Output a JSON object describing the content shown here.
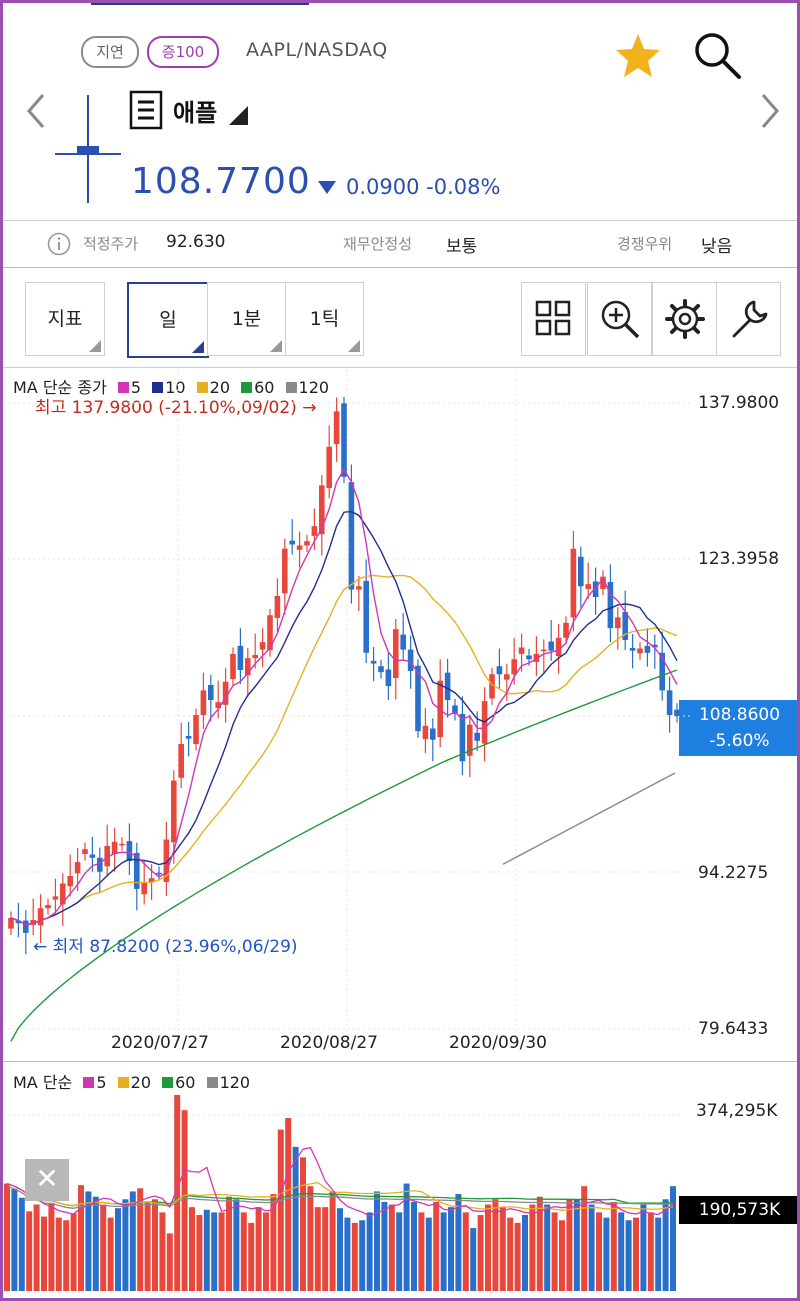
{
  "header": {
    "delay_label": "지연",
    "margin_label": "증100",
    "ticker": "AAPL/NASDAQ",
    "stock_name": "애플",
    "price": "108.7700",
    "change": "0.0900 -0.08%",
    "favorite_icon": "star-icon",
    "search_icon": "search-icon"
  },
  "info": {
    "fair_price_label": "적정주가",
    "fair_price_value": "92.630",
    "stability_label": "재무안정성",
    "stability_value": "보통",
    "competitive_label": "경쟁우위",
    "competitive_value": "낮음"
  },
  "toolbar": {
    "indicator": "지표",
    "period_day": "일",
    "period_min": "1분",
    "period_tick": "1틱",
    "icons": [
      "grid-icon",
      "zoom-in-icon",
      "gear-icon",
      "wrench-icon"
    ]
  },
  "colors": {
    "up": "#e8473c",
    "down": "#2a6fc9",
    "ma5": "#d236b5",
    "ma10": "#1f2f8f",
    "ma20": "#e6b020",
    "ma60": "#1f9a3a",
    "ma120": "#8a8a8a",
    "accent": "#1e7fe0",
    "frame": "#9b4fb0"
  },
  "chart_data": [
    {
      "type": "candlestick",
      "legend": {
        "prefix": "MA 단순 종가",
        "items": [
          {
            "name": "5",
            "color": "#d236b5"
          },
          {
            "name": "10",
            "color": "#1f2f8f"
          },
          {
            "name": "20",
            "color": "#e6b020"
          },
          {
            "name": "60",
            "color": "#1f9a3a"
          },
          {
            "name": "120",
            "color": "#8a8a8a"
          }
        ]
      },
      "y_ticks": [
        "137.9800",
        "123.3958",
        "94.2275",
        "79.6433"
      ],
      "x_ticks": [
        "2020/07/27",
        "2020/08/27",
        "2020/09/30"
      ],
      "ylim": [
        79.6433,
        137.98
      ],
      "high_annotation": "최고 137.9800 (-21.10%,09/02) →",
      "low_annotation": "← 최저 87.8200 (23.96%,06/29)",
      "current_price": "108.8600",
      "current_change": "-5.60%",
      "closes": [
        90.0,
        89.5,
        88.6,
        89.8,
        90.9,
        91.2,
        92.0,
        93.2,
        93.9,
        95.2,
        96.4,
        95.6,
        94.3,
        96.7,
        97.1,
        96.9,
        95.3,
        92.7,
        93.3,
        93.7,
        94.1,
        97.3,
        102.8,
        106.2,
        106.7,
        108.9,
        111.2,
        110.3,
        110.1,
        112.0,
        114.6,
        113.1,
        114.2,
        114.5,
        115.7,
        118.2,
        120.0,
        124.4,
        124.8,
        124.7,
        125.1,
        126.5,
        130.3,
        133.9,
        137.2,
        131.1,
        120.6,
        120.9,
        114.7,
        113.7,
        112.9,
        111.6,
        116.9,
        115.0,
        113.0,
        107.4,
        107.9,
        106.6,
        112.1,
        110.3,
        109.0,
        104.6,
        108.0,
        106.5,
        110.2,
        112.7,
        112.7,
        112.7,
        114.1,
        115.2,
        114.1,
        114.6,
        115.0,
        114.9,
        116.1,
        117.5,
        124.4,
        120.9,
        121.1,
        119.9,
        121.8,
        117.0,
        118.0,
        115.9,
        114.9,
        115.1,
        114.7,
        115.2,
        111.2,
        108.9,
        108.8
      ],
      "ma120": [
        [
          123,
          95.0
        ],
        [
          165,
          100.3
        ]
      ]
    },
    {
      "type": "bar",
      "legend": {
        "prefix": "MA 단순",
        "items": [
          {
            "name": "5",
            "color": "#d236b5"
          },
          {
            "name": "20",
            "color": "#e6b020"
          },
          {
            "name": "60",
            "color": "#1f9a3a"
          },
          {
            "name": "120",
            "color": "#8a8a8a"
          }
        ]
      },
      "y_ticks": [
        "374,295K"
      ],
      "current_volume": "190,573K",
      "ylim": [
        0,
        374295
      ],
      "volumes": [
        205,
        195,
        178,
        152,
        165,
        142,
        168,
        140,
        135,
        148,
        202,
        190,
        180,
        165,
        140,
        158,
        175,
        190,
        196,
        170,
        175,
        150,
        110,
        374,
        345,
        160,
        145,
        155,
        150,
        150,
        180,
        175,
        150,
        130,
        160,
        150,
        185,
        308,
        330,
        275,
        255,
        200,
        160,
        160,
        190,
        158,
        140,
        130,
        135,
        150,
        190,
        170,
        165,
        150,
        205,
        170,
        150,
        140,
        170,
        150,
        160,
        185,
        150,
        120,
        145,
        165,
        175,
        160,
        140,
        130,
        145,
        165,
        180,
        165,
        150,
        135,
        175,
        175,
        200,
        165,
        150,
        140,
        170,
        150,
        135,
        140,
        165,
        150,
        140,
        175,
        200
      ]
    }
  ]
}
